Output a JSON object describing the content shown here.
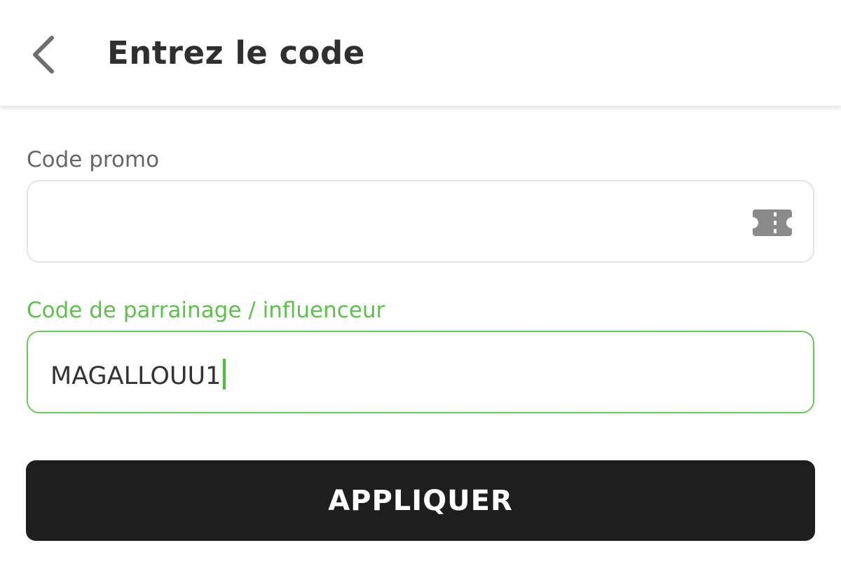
{
  "header": {
    "title": "Entrez le code",
    "back_icon": "chevron-left-icon"
  },
  "promo": {
    "label": "Code promo",
    "value": "",
    "icon": "ticket-icon"
  },
  "referral": {
    "label": "Code de parrainage / influenceur",
    "value": "MAGALLOUU1"
  },
  "actions": {
    "apply_label": "APPLIQUER"
  },
  "colors": {
    "accent": "#6cc759",
    "button_bg": "#1e1e1e",
    "label_gray": "#666666",
    "title": "#2f2f2f"
  }
}
